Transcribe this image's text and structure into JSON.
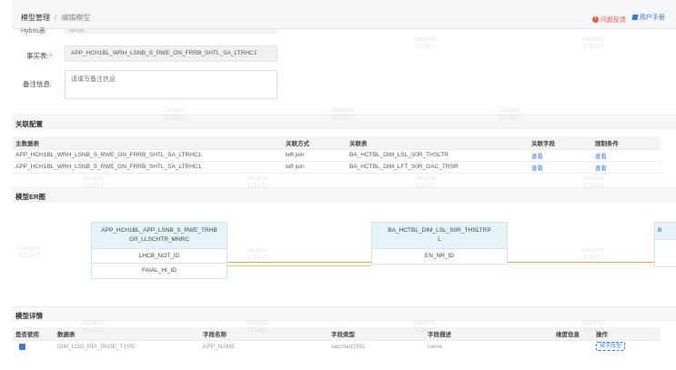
{
  "breadcrumb": {
    "root": "模型管理",
    "separator": "/",
    "current": "编辑模型"
  },
  "header_links": {
    "feedback": "问题反馈",
    "manual": "用户手册"
  },
  "form": {
    "cut_label": "Hybris表:",
    "cut_value": "BASE",
    "fact_label": "事实表:",
    "fact_value": "APP_HCH1BL_WRH_LSNB_S_RWE_GN_FRRB_SHTL_SA_LTRHC1",
    "note_label": "备注信息:",
    "note_placeholder": "请填写备注信息"
  },
  "relation": {
    "title": "关联配置",
    "columns": [
      "主数据表",
      "关联方式",
      "关联表",
      "关联字段",
      "限制条件"
    ],
    "rows": [
      {
        "main": "APP_HCH1BL_WRH_LSNB_S_RWE_GN_FRRB_SHTL_SA_LTRHC1",
        "join": "left join",
        "target": "BA_HCTBL_DIM_LSL_S0R_THSLTR",
        "field_link": "查看",
        "cond_link": "查看"
      },
      {
        "main": "APP_HCH1BL_WRH_LSNB_S_RWE_GN_FRRB_SHTL_SA_LTRHC1",
        "join": "left join",
        "target": "BA_HCTBL_DIM_LFT_S0R_GAC_TRSR",
        "field_link": "查看",
        "cond_link": "查看"
      }
    ]
  },
  "er": {
    "title": "模型ER图",
    "left_box": {
      "title_line1": "APP_HCH1BL_APP_LSNB_S_RWE_TRHB",
      "title_line2": "GR_LLSCHTR_MNRC",
      "fields": [
        "LHCB_NOT_ID",
        "FAIAL_HI_ID"
      ]
    },
    "right_box": {
      "title_line1": "BA_HCTBL_DIM_LSL_S0R_THSLTRP",
      "title_line2": "L",
      "fields": [
        "EN_NR_ID"
      ]
    },
    "edge_label": "B"
  },
  "details": {
    "title": "模型详情",
    "columns": [
      "是否使用",
      "数据表",
      "字段名称",
      "字段类型",
      "字段描述",
      "维度信息",
      "操作"
    ],
    "row": {
      "table": "DIM_LOG_RPI_PAGE_TYPE",
      "field": "APP_NAME",
      "type": "varchar(255)",
      "desc": "name",
      "action": "规字段型"
    }
  },
  "watermark": {
    "line1": "bangcle",
    "line2": "121417"
  },
  "colors": {
    "accent": "#3a7bd5",
    "danger": "#e05a47",
    "er_header": "#e4f4f6",
    "er_line": "#f0a830"
  }
}
